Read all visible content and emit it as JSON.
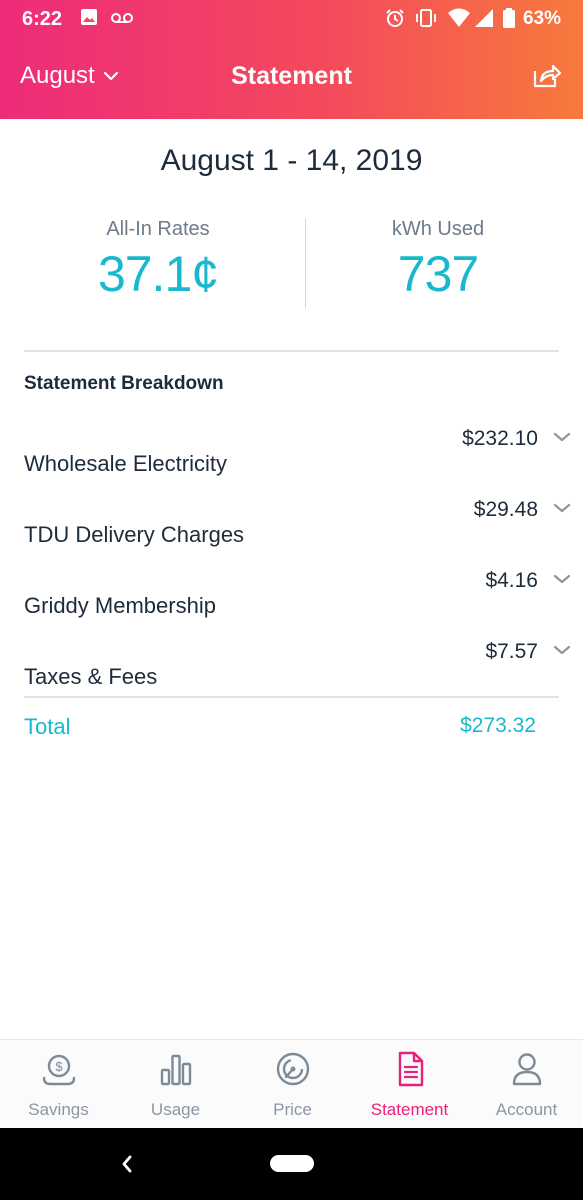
{
  "status_bar": {
    "time": "6:22",
    "battery": "63%"
  },
  "app_bar": {
    "month": "August",
    "title": "Statement"
  },
  "statement": {
    "date_range": "August 1 - 14, 2019",
    "all_in_rates_label": "All-In Rates",
    "all_in_rates_value": "37.1¢",
    "kwh_label": "kWh Used",
    "kwh_value": "737"
  },
  "breakdown": {
    "title": "Statement Breakdown",
    "items": [
      {
        "label": "Wholesale Electricity",
        "amount": "$232.10"
      },
      {
        "label": "TDU Delivery Charges",
        "amount": "$29.48"
      },
      {
        "label": "Griddy Membership",
        "amount": "$4.16"
      },
      {
        "label": "Taxes & Fees",
        "amount": "$7.57"
      }
    ],
    "total_label": "Total",
    "total_amount": "$273.32"
  },
  "bottom_nav": {
    "items": [
      {
        "label": "Savings",
        "icon": "savings-icon"
      },
      {
        "label": "Usage",
        "icon": "usage-icon"
      },
      {
        "label": "Price",
        "icon": "price-icon"
      },
      {
        "label": "Statement",
        "icon": "statement-icon"
      },
      {
        "label": "Account",
        "icon": "account-icon"
      }
    ],
    "active": "Statement"
  },
  "colors": {
    "header_gradient_start": "#ee2b7a",
    "header_gradient_end": "#f77a3c",
    "accent_teal": "#19b8cc",
    "active_pink": "#e8217a",
    "text_dark": "#1d2b3a",
    "muted": "#8a96a3"
  }
}
